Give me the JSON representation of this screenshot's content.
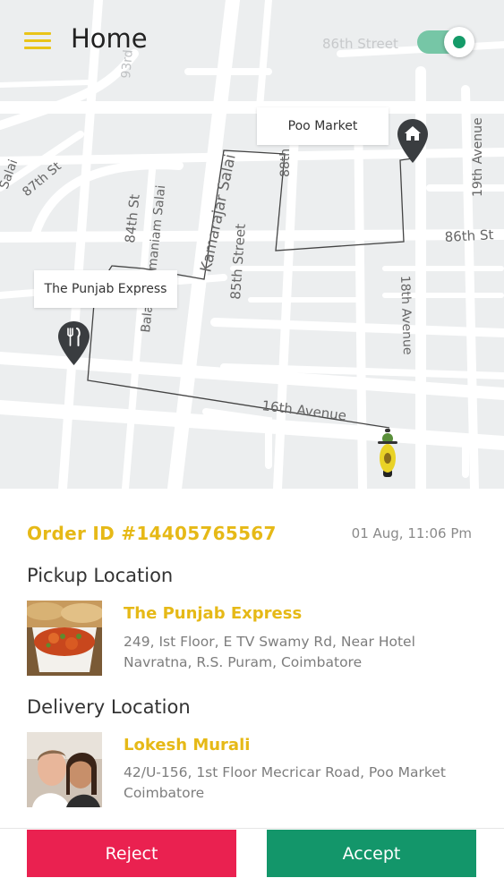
{
  "header": {
    "title": "Home",
    "menu_icon": "hamburger-menu-icon",
    "online_toggle": {
      "state": "on",
      "track_color": "#76c6a6",
      "knob_color": "#159b69"
    }
  },
  "map": {
    "street_labels": [
      "86th Street",
      "93rd",
      "Poo Market",
      "19th Avenue",
      "87th St",
      "88th",
      "Kamarajar Salai",
      "Balasubramaniam Salai",
      "84th St",
      "85th Street",
      "86th St",
      "18th Avenue",
      "16th Avenue",
      "Salai"
    ],
    "pickup_label": "The Punjab Express",
    "drop_label": "Poo Market",
    "pickup_icon": "restaurant-pin-icon",
    "drop_icon": "home-pin-icon",
    "rider_icon": "scooter-icon"
  },
  "order": {
    "id": "Order ID #14405765567",
    "time": "01 Aug, 11:06 Pm"
  },
  "pickup": {
    "section_title": "Pickup Location",
    "name": "The Punjab Express",
    "address_line1": "249, Ist Floor, E TV Swamy Rd, Near Hotel",
    "address_line2": "Navratna, R.S. Puram, Coimbatore"
  },
  "delivery": {
    "section_title": "Delivery Location",
    "name": "Lokesh Murali",
    "address_line1": "42/U-156, 1st Floor Mecricar Road, Poo Market",
    "address_line2": "Coimbatore"
  },
  "actions": {
    "reject_label": "Reject",
    "accept_label": "Accept"
  },
  "colors": {
    "accent": "#e6b917",
    "reject": "#ea2150",
    "accept": "#13966a"
  }
}
